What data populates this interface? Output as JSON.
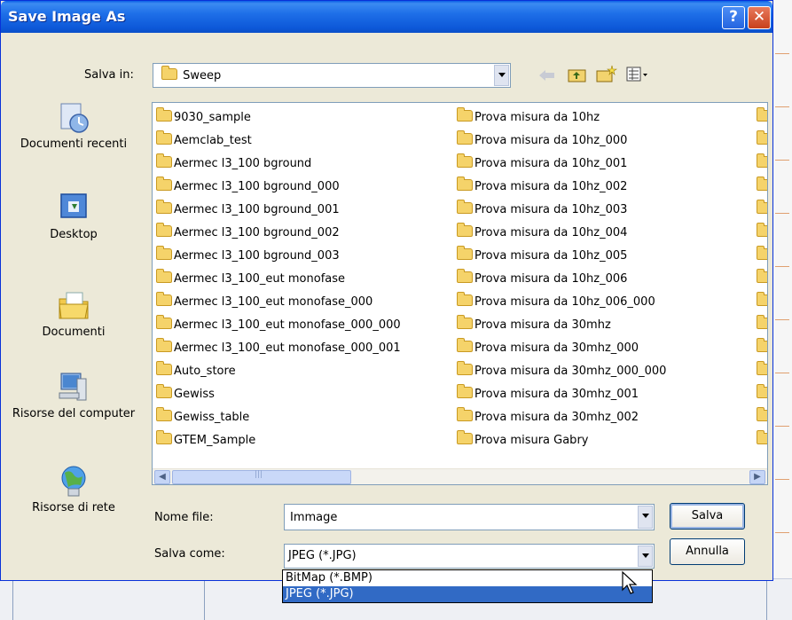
{
  "window": {
    "title": "Save Image As",
    "help_glyph": "?",
    "close_glyph": "✕"
  },
  "look_in": {
    "label": "Salva in:",
    "value": "Sweep"
  },
  "toolbar_icons": [
    "back-icon",
    "up-folder-icon",
    "new-folder-icon",
    "view-menu-icon"
  ],
  "places": [
    {
      "label": "Documenti recenti",
      "icon": "recent-documents-icon"
    },
    {
      "label": "Desktop",
      "icon": "desktop-icon"
    },
    {
      "label": "Documenti",
      "icon": "documents-icon"
    },
    {
      "label": "Risorse del computer",
      "icon": "my-computer-icon"
    },
    {
      "label": "Risorse di rete",
      "icon": "network-icon"
    }
  ],
  "files_col1": [
    "9030_sample",
    "Aemclab_test",
    "Aermec l3_100 bground",
    "Aermec l3_100 bground_000",
    "Aermec l3_100 bground_001",
    "Aermec l3_100 bground_002",
    "Aermec l3_100 bground_003",
    "Aermec l3_100_eut monofase",
    "Aermec l3_100_eut monofase_000",
    "Aermec l3_100_eut monofase_000_000",
    "Aermec l3_100_eut monofase_000_001",
    "Auto_store",
    "Gewiss",
    "Gewiss_table",
    "GTEM_Sample"
  ],
  "files_col2": [
    "Prova misura da 10hz",
    "Prova misura da 10hz_000",
    "Prova misura da 10hz_001",
    "Prova misura da 10hz_002",
    "Prova misura da 10hz_003",
    "Prova misura da 10hz_004",
    "Prova misura da 10hz_005",
    "Prova misura da 10hz_006",
    "Prova misura da 10hz_006_000",
    "Prova misura da 30mhz",
    "Prova misura da 30mhz_000",
    "Prova misura da 30mhz_000_000",
    "Prova misura da 30mhz_001",
    "Prova misura da 30mhz_002",
    "Prova misura Gabry"
  ],
  "filename": {
    "label": "Nome file:",
    "value": "Immage"
  },
  "filetype": {
    "label": "Salva come:",
    "value": "JPEG (*.JPG)",
    "options": [
      "BitMap (*.BMP)",
      "JPEG (*.JPG)"
    ],
    "selected_index": 1
  },
  "buttons": {
    "save": "Salva",
    "cancel": "Annulla"
  },
  "colors": {
    "title_bar": "#0a5fe6",
    "dialog_bg": "#ece9d8",
    "selection": "#316ac5",
    "folder": "#f5d36a"
  }
}
